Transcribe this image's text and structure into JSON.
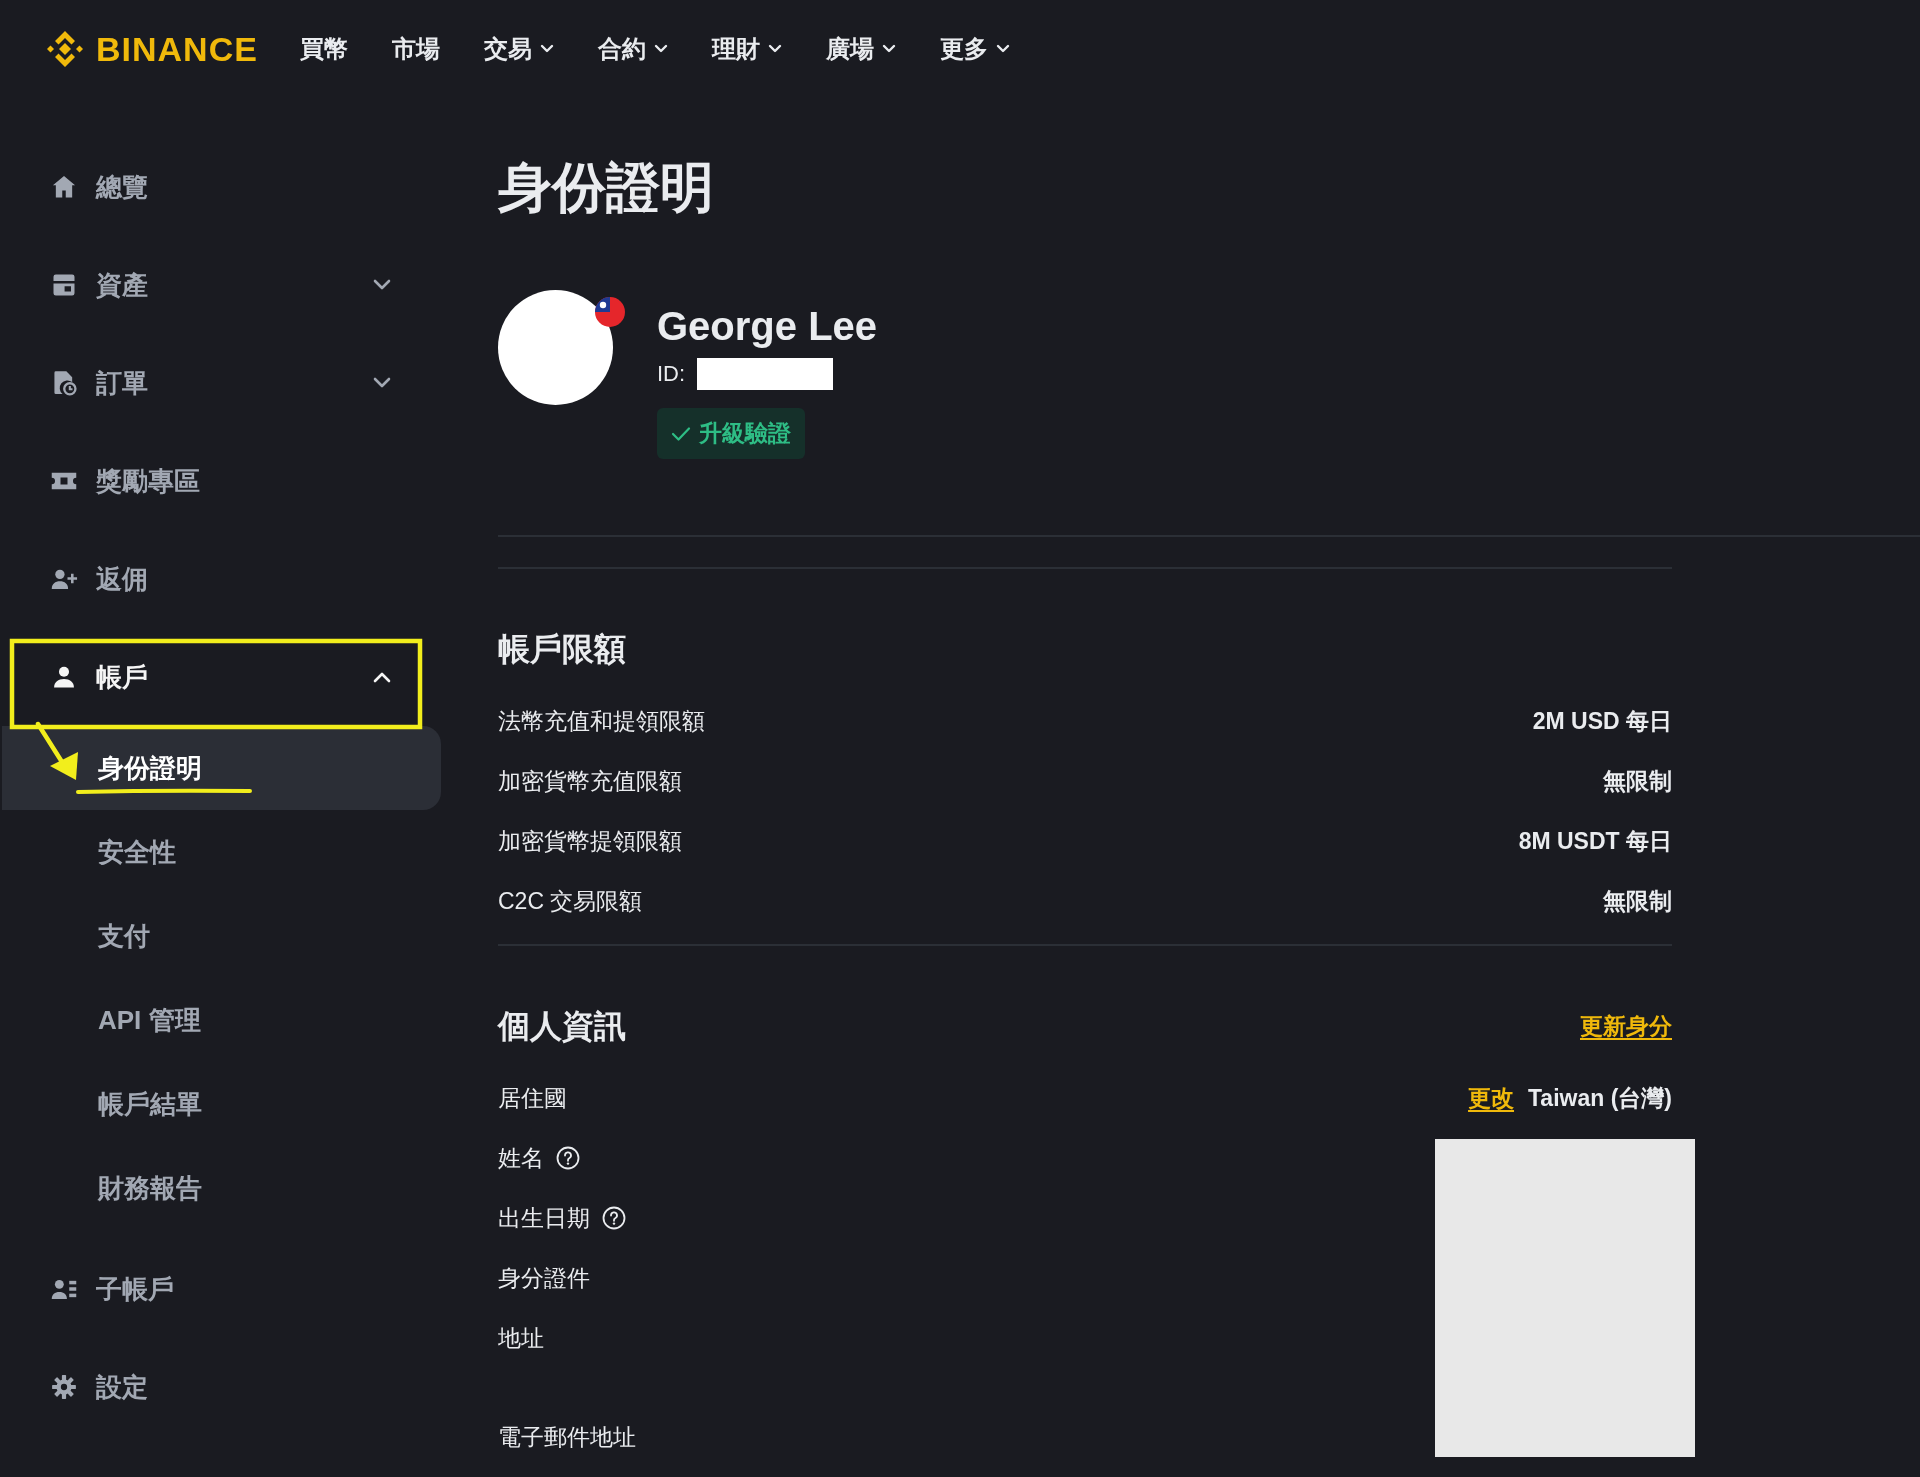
{
  "header": {
    "logo": "BINANCE",
    "nav": [
      {
        "label": "買幣",
        "dropdown": false
      },
      {
        "label": "市場",
        "dropdown": false
      },
      {
        "label": "交易",
        "dropdown": true
      },
      {
        "label": "合約",
        "dropdown": true
      },
      {
        "label": "理財",
        "dropdown": true
      },
      {
        "label": "廣場",
        "dropdown": true
      },
      {
        "label": "更多",
        "dropdown": true
      }
    ]
  },
  "sidebar": {
    "items": [
      {
        "kind": "link",
        "label": "總覽"
      },
      {
        "kind": "group",
        "label": "資產",
        "expanded": false
      },
      {
        "kind": "group",
        "label": "訂單",
        "expanded": false
      },
      {
        "kind": "link",
        "label": "獎勵專區"
      },
      {
        "kind": "link",
        "label": "返佣"
      },
      {
        "kind": "group",
        "label": "帳戶",
        "expanded": true,
        "children": [
          {
            "label": "身份證明",
            "selected": true
          },
          {
            "label": "安全性",
            "selected": false
          },
          {
            "label": "支付",
            "selected": false
          },
          {
            "label": "API 管理",
            "selected": false
          },
          {
            "label": "帳戶結單",
            "selected": false
          },
          {
            "label": "財務報告",
            "selected": false
          }
        ]
      },
      {
        "kind": "link",
        "label": "子帳戶"
      },
      {
        "kind": "link",
        "label": "設定"
      }
    ]
  },
  "page_title": "身份證明",
  "profile": {
    "name": "George Lee",
    "id_label": "ID:",
    "upgrade_button": "升級驗證"
  },
  "account_limits": {
    "title": "帳戶限額",
    "rows": [
      {
        "label": "法幣充值和提領限額",
        "value": "2M USD 每日"
      },
      {
        "label": "加密貨幣充值限額",
        "value": "無限制"
      },
      {
        "label": "加密貨幣提領限額",
        "value": "8M USDT 每日"
      },
      {
        "label": "C2C 交易限額",
        "value": "無限制"
      }
    ]
  },
  "personal_info": {
    "title": "個人資訊",
    "action": "更新身分",
    "rows": [
      {
        "label": "居住國",
        "help": false,
        "action": "更改",
        "value": "Taiwan (台灣)"
      },
      {
        "label": "姓名",
        "help": true
      },
      {
        "label": "出生日期",
        "help": true
      },
      {
        "label": "身分證件",
        "help": false
      },
      {
        "label": "地址",
        "help": false
      },
      {
        "label": "電子郵件地址",
        "help": false
      }
    ]
  }
}
